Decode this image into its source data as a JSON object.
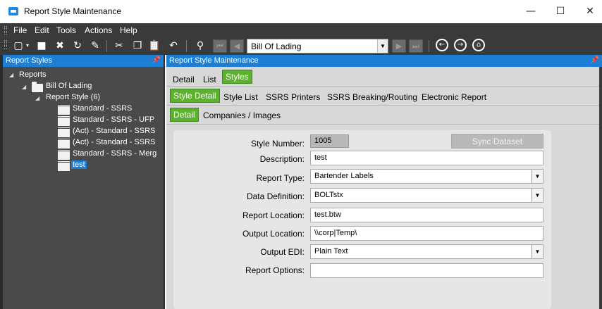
{
  "window": {
    "title": "Report Style Maintenance",
    "minimize": "—",
    "maximize": "☐",
    "close": "✕"
  },
  "menu": [
    "File",
    "Edit",
    "Tools",
    "Actions",
    "Help"
  ],
  "toolbar": {
    "record_combo": "Bill Of Lading"
  },
  "left_panel": {
    "title": "Report Styles",
    "tree": {
      "root": "Reports",
      "group": "Bill Of Lading",
      "subgroup": "Report Style (6)",
      "items": [
        "Standard - SSRS",
        "Standard - SSRS - UFP",
        "(Act) - Standard - SSRS",
        "(Act) - Standard - SSRS",
        "Standard - SSRS - Merg",
        "test"
      ]
    }
  },
  "right_panel": {
    "title": "Report Style Maintenance",
    "tabs1": [
      "Detail",
      "List",
      "Styles"
    ],
    "tabs2": [
      "Style Detail",
      "Style List",
      "SSRS Printers",
      "SSRS Breaking/Routing",
      "Electronic Report"
    ],
    "tabs3": [
      "Detail",
      "Companies / Images"
    ]
  },
  "form": {
    "style_number": {
      "label": "Style Number:",
      "value": "1005"
    },
    "sync_button": "Sync Dataset",
    "description": {
      "label": "Description:",
      "value": "test"
    },
    "report_type": {
      "label": "Report Type:",
      "value": "Bartender Labels"
    },
    "data_definition": {
      "label": "Data Definition:",
      "value": "BOLTstx"
    },
    "report_location": {
      "label": "Report Location:",
      "value": "test.btw"
    },
    "output_location": {
      "label": "Output Location:",
      "value": "\\\\corp|Temp\\"
    },
    "output_edi": {
      "label": "Output EDI:",
      "value": "Plain Text"
    },
    "report_options": {
      "label": "Report Options:",
      "value": ""
    }
  },
  "colors": {
    "accent_blue": "#1c7fd4",
    "active_tab_green": "#5db12f",
    "dark_chrome": "#3a3a3a"
  }
}
